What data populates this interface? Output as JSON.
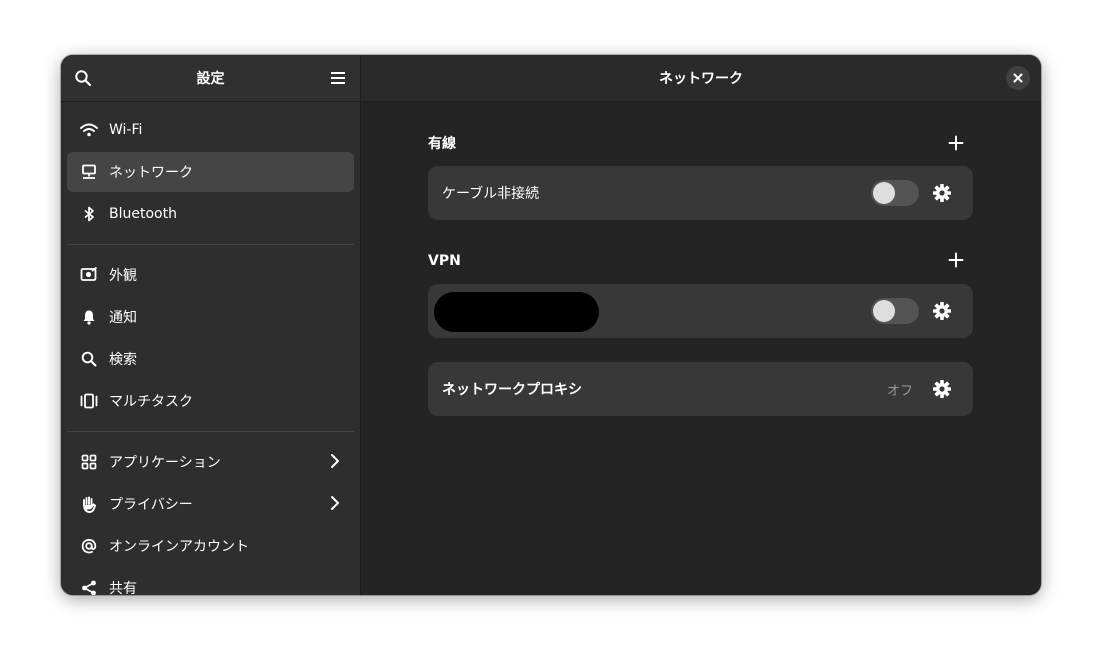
{
  "sidebar": {
    "title": "設定",
    "items_group1": [
      {
        "label": "Wi-Fi",
        "icon": "wifi-icon"
      },
      {
        "label": "ネットワーク",
        "icon": "network-icon",
        "active": true
      },
      {
        "label": "Bluetooth",
        "icon": "bluetooth-icon"
      }
    ],
    "items_group2": [
      {
        "label": "外観",
        "icon": "appearance-icon"
      },
      {
        "label": "通知",
        "icon": "bell-icon"
      },
      {
        "label": "検索",
        "icon": "search-icon"
      },
      {
        "label": "マルチタスク",
        "icon": "multitasking-icon"
      }
    ],
    "items_group3": [
      {
        "label": "アプリケーション",
        "icon": "apps-icon",
        "has_chevron": true
      },
      {
        "label": "プライバシー",
        "icon": "hand-icon",
        "has_chevron": true
      },
      {
        "label": "オンラインアカウント",
        "icon": "at-icon"
      },
      {
        "label": "共有",
        "icon": "share-icon"
      }
    ]
  },
  "main": {
    "title": "ネットワーク",
    "wired": {
      "label": "有線",
      "connection_label": "ケーブル非接続",
      "toggle_on": false
    },
    "vpn": {
      "label": "VPN",
      "toggle_on": false
    },
    "proxy": {
      "label": "ネットワークプロキシ",
      "status": "オフ"
    }
  },
  "colors": {
    "window_bg": "#242424",
    "sidebar_bg": "#2e2e2e",
    "card_bg": "#383838",
    "highlight_ring": "#e01b24"
  }
}
